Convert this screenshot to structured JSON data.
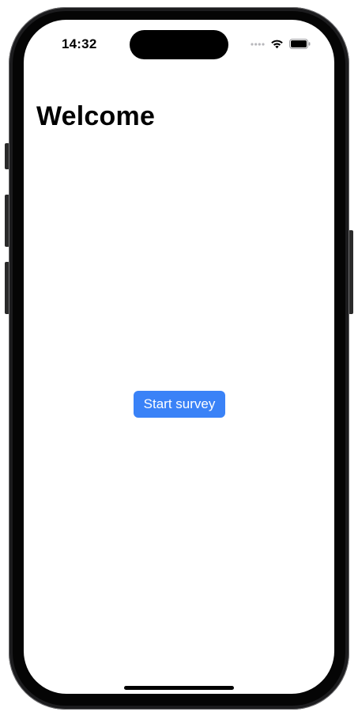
{
  "status_bar": {
    "time": "14:32"
  },
  "main": {
    "title": "Welcome",
    "start_button_label": "Start survey"
  },
  "colors": {
    "button_background": "#3a82f7",
    "button_text": "#ffffff",
    "screen_background": "#ffffff",
    "frame": "#1c1c1e"
  },
  "icons": {
    "signal": "signal-dots-icon",
    "wifi": "wifi-icon",
    "battery": "battery-icon"
  }
}
